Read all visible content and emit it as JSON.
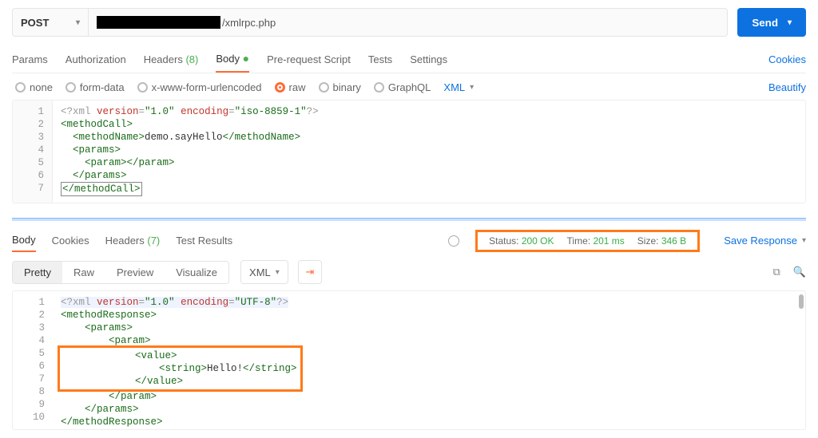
{
  "request": {
    "method": "POST",
    "url_suffix": "/xmlrpc.php",
    "send_label": "Send"
  },
  "req_tabs": {
    "params": "Params",
    "auth": "Authorization",
    "headers": "Headers",
    "headers_count": "(8)",
    "body": "Body",
    "prerequest": "Pre-request Script",
    "tests": "Tests",
    "settings": "Settings",
    "cookies": "Cookies"
  },
  "body_types": {
    "none": "none",
    "formdata": "form-data",
    "urlencoded": "x-www-form-urlencoded",
    "raw": "raw",
    "binary": "binary",
    "graphql": "GraphQL",
    "lang": "XML",
    "beautify": "Beautify"
  },
  "req_body": {
    "l1_a": "<?xml ",
    "l1_b": "version",
    "l1_c": "=",
    "l1_d": "\"1.0\"",
    "l1_e": " encoding",
    "l1_f": "=",
    "l1_g": "\"iso-8859-1\"",
    "l1_h": "?>",
    "l2": "<methodCall>",
    "l3_a": "  <methodName>",
    "l3_b": "demo.sayHello",
    "l3_c": "</methodName>",
    "l4": "  <params>",
    "l5_a": "    <param>",
    "l5_b": "</param>",
    "l6": "  </params>",
    "l7": "</methodCall>"
  },
  "req_lines": {
    "n1": "1",
    "n2": "2",
    "n3": "3",
    "n4": "4",
    "n5": "5",
    "n6": "6",
    "n7": "7"
  },
  "resp_tabs": {
    "body": "Body",
    "cookies": "Cookies",
    "headers": "Headers",
    "headers_count": "(7)",
    "results": "Test Results",
    "save": "Save Response"
  },
  "status": {
    "label_status": "Status:",
    "status_val": "200 OK",
    "label_time": "Time:",
    "time_val": "201 ms",
    "label_size": "Size:",
    "size_val": "346 B"
  },
  "resp_toolbar": {
    "pretty": "Pretty",
    "raw": "Raw",
    "preview": "Preview",
    "visualize": "Visualize",
    "lang": "XML"
  },
  "resp_body": {
    "l1_a": "<?xml ",
    "l1_b": "version",
    "l1_c": "=",
    "l1_d": "\"1.0\"",
    "l1_e": " encoding",
    "l1_f": "=",
    "l1_g": "\"UTF-8\"",
    "l1_h": "?>",
    "l2": "<methodResponse>",
    "l3": "    <params>",
    "l4": "        <param>",
    "l5": "            <value>",
    "l6_a": "                <string>",
    "l6_b": "Hello!",
    "l6_c": "</string>",
    "l7": "            </value>",
    "l8": "        </param>",
    "l9": "    </params>",
    "l10": "</methodResponse>"
  },
  "resp_lines": {
    "n1": "1",
    "n2": "2",
    "n3": "3",
    "n4": "4",
    "n5": "5",
    "n6": "6",
    "n7": "7",
    "n8": "8",
    "n9": "9",
    "n10": "10"
  }
}
